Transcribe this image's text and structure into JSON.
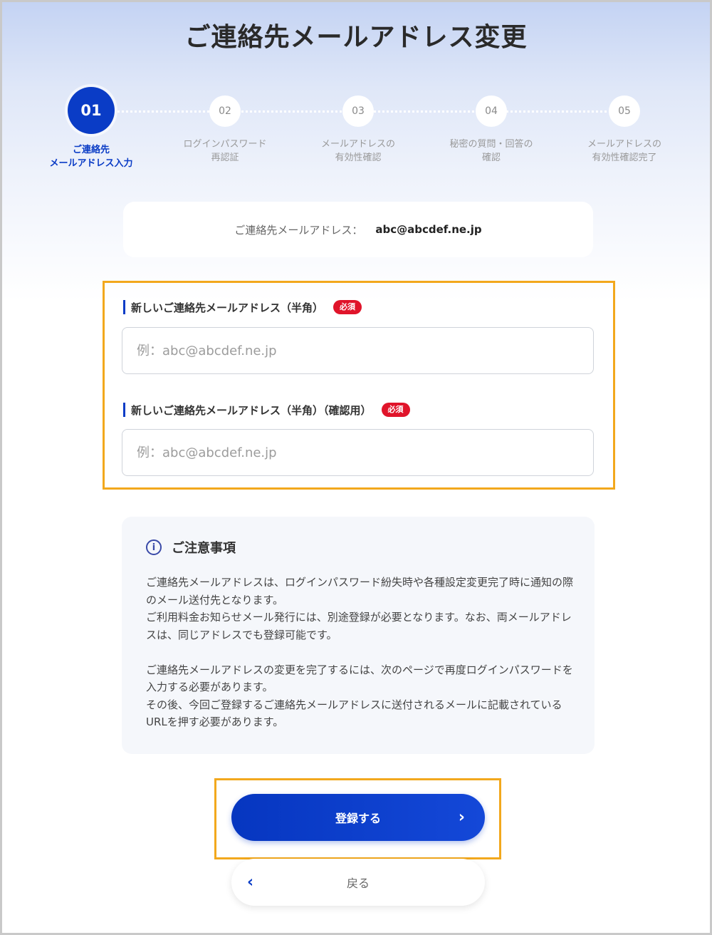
{
  "page": {
    "title": "ご連絡先メールアドレス変更"
  },
  "stepper": {
    "steps": [
      {
        "number": "01",
        "label": "ご連絡先\nメールアドレス入力",
        "state": "active"
      },
      {
        "number": "02",
        "label": "ログインパスワード\n再認証",
        "state": "inactive"
      },
      {
        "number": "03",
        "label": "メールアドレスの\n有効性確認",
        "state": "inactive"
      },
      {
        "number": "04",
        "label": "秘密の質問・回答の\n確認",
        "state": "inactive"
      },
      {
        "number": "05",
        "label": "メールアドレスの\n有効性確認完了",
        "state": "inactive"
      }
    ]
  },
  "current_email": {
    "label": "ご連絡先メールアドレス：",
    "value": "abc@abcdef.ne.jp"
  },
  "form": {
    "new_email": {
      "label": "新しいご連絡先メールアドレス（半角）",
      "required": "必須",
      "placeholder": "例：abc@abcdef.ne.jp"
    },
    "confirm_email": {
      "label": "新しいご連絡先メールアドレス（半角）（確認用）",
      "required": "必須",
      "placeholder": "例：abc@abcdef.ne.jp"
    }
  },
  "notice": {
    "icon": "info-icon",
    "title": "ご注意事項",
    "body": "ご連絡先メールアドレスは、ログインパスワード紛失時や各種設定変更完了時に通知の際のメール送付先となります。\nご利用料金お知らせメール発行には、別途登録が必要となります。なお、両メールアドレスは、同じアドレスでも登録可能です。\n\nご連絡先メールアドレスの変更を完了するには、次のページで再度ログインパスワードを入力する必要があります。\nその後、今回ご登録するご連絡先メールアドレスに送付されるメールに記載されているURLを押す必要があります。"
  },
  "buttons": {
    "submit": "登録する",
    "back": "戻る"
  },
  "colors": {
    "primary": "#0a3cc6",
    "required_badge": "#e0142a",
    "highlight": "#f2a81d"
  }
}
